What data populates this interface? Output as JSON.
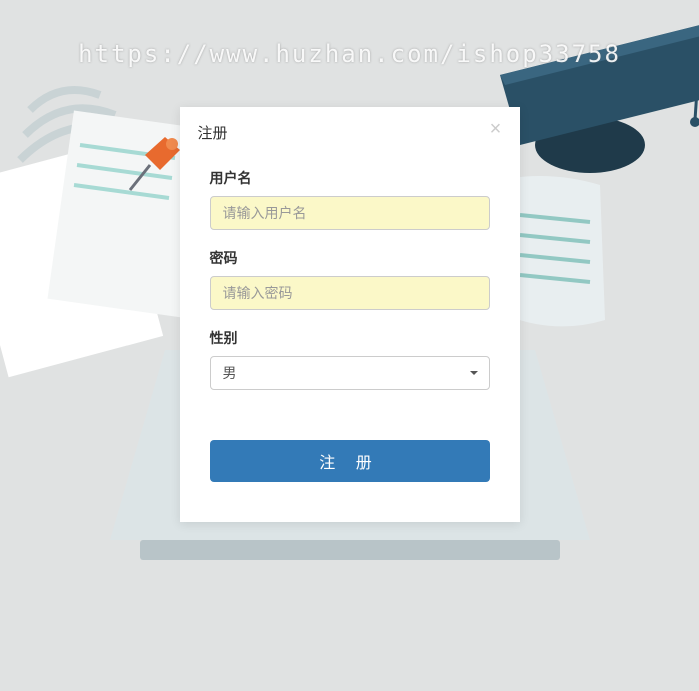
{
  "watermark": "https://www.huzhan.com/ishop33758",
  "modal": {
    "title": "注册",
    "fields": {
      "username": {
        "label": "用户名",
        "placeholder": "请输入用户名",
        "value": ""
      },
      "password": {
        "label": "密码",
        "placeholder": "请输入密码",
        "value": ""
      },
      "gender": {
        "label": "性别",
        "selected": "男"
      }
    },
    "submit_label": "注 册"
  }
}
